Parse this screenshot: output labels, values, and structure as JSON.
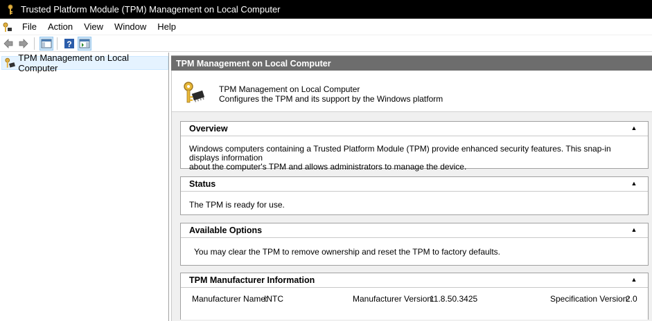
{
  "window": {
    "title": "Trusted Platform Module (TPM) Management on Local Computer"
  },
  "menu": {
    "items": [
      "File",
      "Action",
      "View",
      "Window",
      "Help"
    ]
  },
  "toolbar": {
    "icons": [
      "back-arrow-icon",
      "forward-arrow-icon",
      "show-hide-console-tree-icon",
      "help-icon",
      "show-hide-action-pane-icon"
    ]
  },
  "tree": {
    "selected_label": "TPM Management on Local Computer"
  },
  "right_pane": {
    "header": "TPM Management on Local Computer",
    "intro": {
      "title": "TPM Management on Local Computer",
      "description": "Configures the TPM and its support by the Windows platform"
    },
    "sections": {
      "overview": {
        "title": "Overview",
        "line1": "Windows computers containing a Trusted Platform Module (TPM) provide enhanced security features. This snap-in displays information",
        "line2": "about the computer's TPM and allows administrators to manage the device."
      },
      "status": {
        "title": "Status",
        "text": "The TPM is ready for use."
      },
      "options": {
        "title": "Available Options",
        "text": "You may clear the TPM to remove ownership and reset the TPM to factory defaults."
      },
      "manufacturer": {
        "title": "TPM Manufacturer Information",
        "name_label": "Manufacturer Name:",
        "name_value": "INTC",
        "version_label": "Manufacturer Version:",
        "version_value": "11.8.50.3425",
        "spec_label": "Specification Version:",
        "spec_value": "2.0"
      }
    }
  },
  "colors": {
    "titlebar": "#000000",
    "pane_header": "#6d6d6d",
    "selection": "#e5f3ff"
  }
}
